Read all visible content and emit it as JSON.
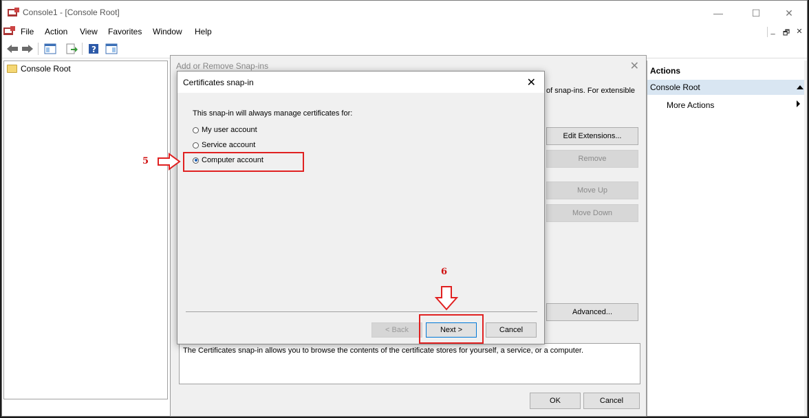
{
  "window": {
    "title": "Console1 - [Console Root]",
    "minimize": "—",
    "maximize": "☐",
    "close": "✕"
  },
  "menubar": {
    "items": [
      "File",
      "Action",
      "View",
      "Favorites",
      "Window",
      "Help"
    ],
    "mdi_minimize": "_",
    "mdi_restore": "🗗",
    "mdi_close": "✕"
  },
  "scope": {
    "root_label": "Console Root"
  },
  "actions": {
    "header": "Actions",
    "selected": "Console Root",
    "more": "More Actions"
  },
  "add_remove": {
    "title": "Add or Remove Snap-ins",
    "close": "✕",
    "desc_fragment": "of snap-ins. For extensible",
    "buttons": {
      "edit_extensions": "Edit Extensions...",
      "remove": "Remove",
      "move_up": "Move Up",
      "move_down": "Move Down",
      "advanced": "Advanced..."
    },
    "description": "The Certificates snap-in allows you to browse the contents of the certificate stores for yourself, a service, or a computer.",
    "ok": "OK",
    "cancel": "Cancel"
  },
  "cert_dialog": {
    "title": "Certificates snap-in",
    "close": "✕",
    "prompt": "This snap-in will always manage certificates for:",
    "options": [
      {
        "label": "My user account",
        "checked": false
      },
      {
        "label": "Service account",
        "checked": false
      },
      {
        "label": "Computer account",
        "checked": true
      }
    ],
    "back": "< Back",
    "next": "Next >",
    "cancel": "Cancel"
  },
  "annotations": {
    "step5": "5",
    "step6": "6",
    "color": "#e02020"
  }
}
